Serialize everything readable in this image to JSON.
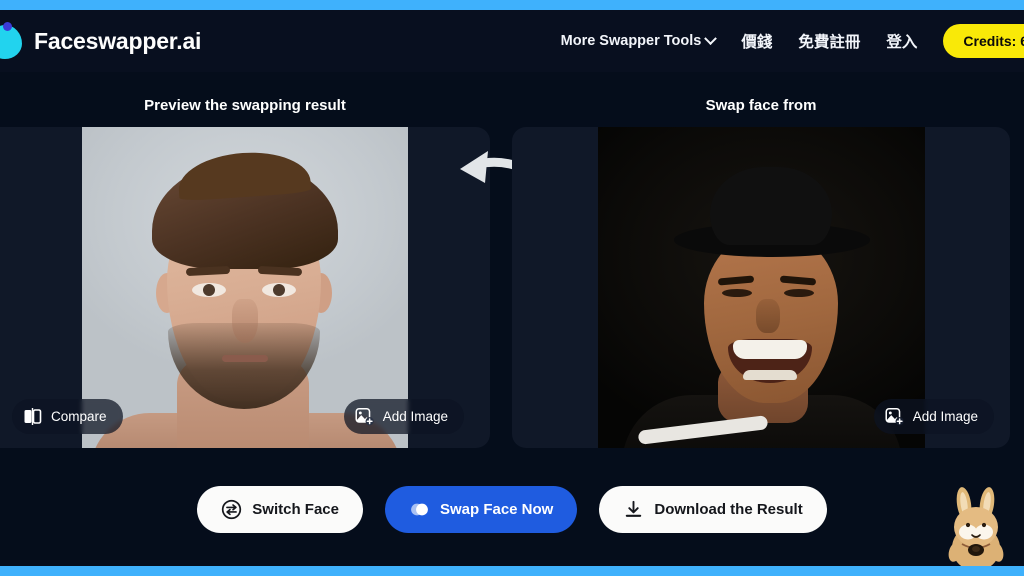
{
  "brand": {
    "name": "Faceswapper.ai",
    "logo_icon": "cyan-blob-logo-icon",
    "accent_color": "#3fb1fc",
    "logo_color": "#22d3ee"
  },
  "nav": {
    "items": [
      {
        "label": "More Swapper Tools",
        "icon": "chevron-down-icon",
        "has_chevron": true,
        "cjk": false
      },
      {
        "label": "價錢",
        "has_chevron": false,
        "cjk": true
      },
      {
        "label": "免費註冊",
        "has_chevron": false,
        "cjk": true
      },
      {
        "label": "登入",
        "has_chevron": false,
        "cjk": true
      }
    ],
    "credits": {
      "label": "Credits: 6",
      "bg_color": "#f9e908",
      "text_color": "#0a0a0a"
    }
  },
  "panels": {
    "left": {
      "title": "Preview the swapping result",
      "compare": {
        "label": "Compare",
        "icon": "compare-split-icon"
      },
      "add_image": {
        "label": "Add Image",
        "icon": "add-image-icon"
      }
    },
    "right": {
      "title": "Swap face from",
      "add_image": {
        "label": "Add Image",
        "icon": "add-image-icon"
      }
    },
    "arrow_icon": "curved-left-arrow-icon"
  },
  "actions": [
    {
      "label": "Switch Face",
      "icon": "switch-face-icon",
      "style": "light"
    },
    {
      "label": "Swap Face Now",
      "icon": "swap-faces-icon",
      "style": "primary",
      "bg_color": "#1f5ce0"
    },
    {
      "label": "Download the Result",
      "icon": "download-icon",
      "style": "light"
    }
  ],
  "mascot": {
    "icon": "rabbit-mascot-icon"
  }
}
